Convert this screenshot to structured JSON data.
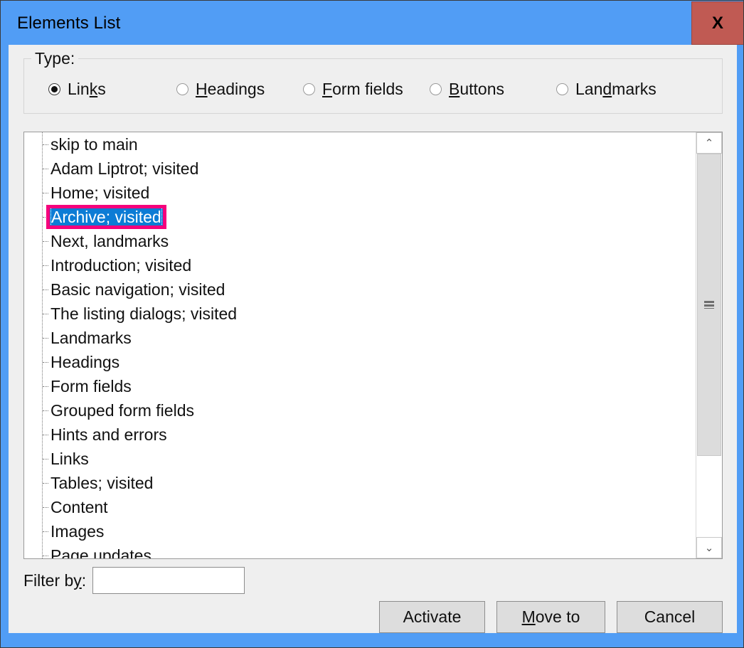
{
  "window": {
    "title": "Elements List",
    "close_label": "X",
    "titlebar_color": "#519df5",
    "close_button_color": "#c05a53"
  },
  "type_group": {
    "legend": "Type:",
    "options": [
      {
        "label": "Links",
        "pre": "Lin",
        "key": "k",
        "post": "s",
        "checked": true
      },
      {
        "label": "Headings",
        "pre": "",
        "key": "H",
        "post": "eadings",
        "checked": false
      },
      {
        "label": "Form fields",
        "pre": "",
        "key": "F",
        "post": "orm fields",
        "checked": false
      },
      {
        "label": "Buttons",
        "pre": "",
        "key": "B",
        "post": "uttons",
        "checked": false
      },
      {
        "label": "Landmarks",
        "pre": "Lan",
        "key": "d",
        "post": "marks",
        "checked": false
      }
    ]
  },
  "elements_list": {
    "selected_index": 3,
    "selection_color": "#0c7cd5",
    "focus_ring_color": "#f5027c",
    "items": [
      {
        "label": "skip to main"
      },
      {
        "label": "Adam Liptrot; visited"
      },
      {
        "label": "Home; visited"
      },
      {
        "label": "Archive; visited"
      },
      {
        "label": "Next, landmarks"
      },
      {
        "label": "Introduction; visited"
      },
      {
        "label": "Basic navigation; visited"
      },
      {
        "label": "The listing dialogs; visited"
      },
      {
        "label": "Landmarks"
      },
      {
        "label": "Headings"
      },
      {
        "label": "Form fields"
      },
      {
        "label": "Grouped form fields"
      },
      {
        "label": "Hints and errors"
      },
      {
        "label": "Links"
      },
      {
        "label": "Tables; visited"
      },
      {
        "label": "Content"
      },
      {
        "label": "Images"
      },
      {
        "label": "Page updates"
      }
    ],
    "scrollbar": {
      "up_arrow": "⌃",
      "down_arrow": "⌄"
    }
  },
  "filter": {
    "label_pre": "Filter b",
    "label_key": "y",
    "label_post": ":",
    "value": "",
    "placeholder": ""
  },
  "buttons": [
    {
      "pre": "Activate",
      "key": "",
      "post": ""
    },
    {
      "pre": "",
      "key": "M",
      "post": "ove to"
    },
    {
      "pre": "Cancel",
      "key": "",
      "post": ""
    }
  ]
}
